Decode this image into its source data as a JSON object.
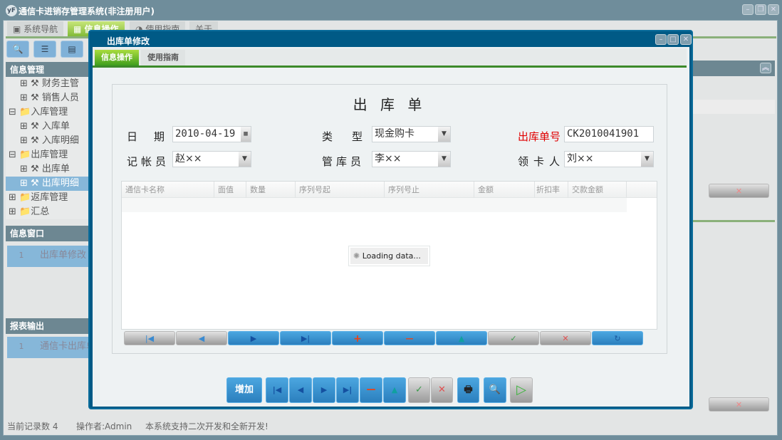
{
  "app": {
    "title": "通信卡进销存管理系统(非注册用户)"
  },
  "main_tabs": [
    "系统导航",
    "信息操作",
    "使用指南",
    "关于"
  ],
  "sidebar": {
    "info_mgmt": "信息管理",
    "tree": [
      {
        "label": "财务主管",
        "level": 2
      },
      {
        "label": "销售人员",
        "level": 2
      },
      {
        "label": "入库管理",
        "level": 1
      },
      {
        "label": "入库单",
        "level": 2
      },
      {
        "label": "入库明细",
        "level": 2
      },
      {
        "label": "出库管理",
        "level": 1
      },
      {
        "label": "出库单",
        "level": 2
      },
      {
        "label": "出库明细",
        "level": 2,
        "selected": true
      },
      {
        "label": "返库管理",
        "level": 1
      },
      {
        "label": "汇总",
        "level": 1
      }
    ],
    "info_window": "信息窗口",
    "info_window_rows": [
      {
        "no": "1",
        "label": "出库单修改"
      }
    ],
    "report_output": "报表输出",
    "report_rows": [
      {
        "no": "1",
        "label": "通信卡出库单"
      }
    ]
  },
  "status": {
    "record_count": "当前记录数 4",
    "operator": "操作者:Admin",
    "notice": "本系统支持二次开发和全新开发!"
  },
  "dialog": {
    "title": "出库单修改",
    "tabs": [
      "信息操作",
      "使用指南"
    ],
    "form_title": "出 库 单",
    "fields": {
      "date": {
        "label": "日　期",
        "value": "2010-04-19"
      },
      "type": {
        "label": "类　型",
        "value": "现金购卡"
      },
      "order_no": {
        "label": "出库单号",
        "value": "CK2010041901"
      },
      "bookkeeper": {
        "label": "记帐员",
        "value": "赵××"
      },
      "keeper": {
        "label": "管库员",
        "value": "李××"
      },
      "receiver": {
        "label": "领卡人",
        "value": "刘××"
      }
    },
    "grid": {
      "columns": [
        "通信卡名称",
        "面值",
        "数量",
        "序列号起",
        "序列号止",
        "金额",
        "折扣率",
        "交款金额"
      ],
      "loading": "Loading data..."
    },
    "add_label": "增加"
  },
  "colors": {
    "accent_green": "#7fb834",
    "dialog_frame": "#005a86",
    "required_label": "#e00000"
  }
}
